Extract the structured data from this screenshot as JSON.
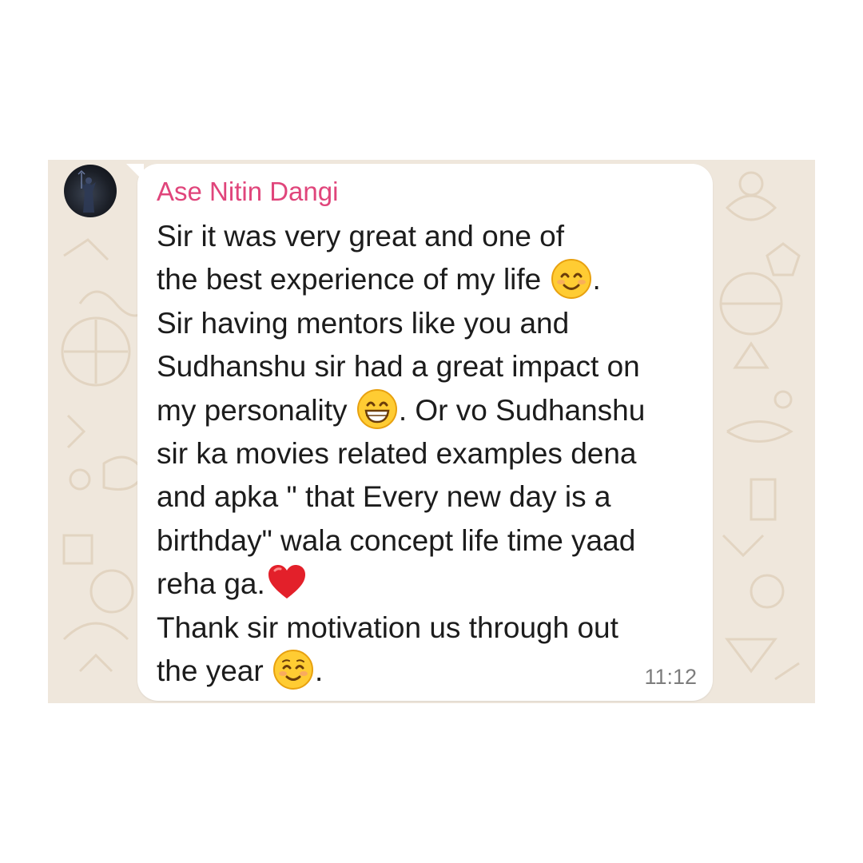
{
  "message": {
    "sender_name": "Ase Nitin Dangi",
    "time": "11:12",
    "sender_color": "#e0457b",
    "lines": [
      {
        "text": "Sir it was very great and one of"
      },
      {
        "text": "the best experience of my life",
        "emoji": "smiling-face-with-smiling-eyes",
        "after": "."
      },
      {
        "text": "Sir having mentors like you and"
      },
      {
        "text": "Sudhanshu sir had a great impact on"
      },
      {
        "text": "my personality",
        "emoji": "grinning-face-with-smiling-eyes",
        "after": ". Or vo Sudhanshu"
      },
      {
        "text": "sir ka movies related examples dena"
      },
      {
        "text": "and apka \" that Every new day is a"
      },
      {
        "text": "birthday\" wala concept life time yaad"
      },
      {
        "text": "reha ga.",
        "emoji": "red-heart",
        "after": ""
      },
      {
        "text": "Thank sir motivation us through out"
      },
      {
        "text": "the year",
        "emoji": "smiling-face",
        "after": "."
      }
    ]
  },
  "colors": {
    "chat_background": "#efe7dc",
    "bubble": "#ffffff",
    "text": "#1c1c1c",
    "timestamp": "#7d7d7d"
  }
}
